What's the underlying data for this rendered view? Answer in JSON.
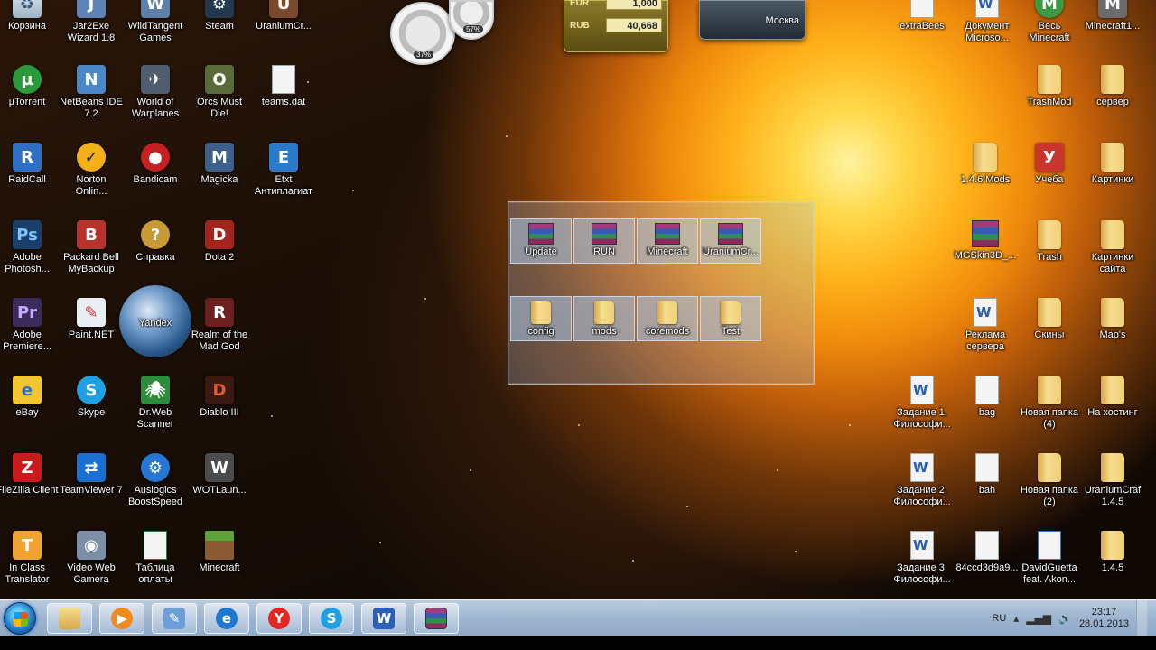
{
  "desktop": {
    "col1": [
      "Корзина",
      "µTorrent",
      "RaidCall",
      "Adobe Photosh...",
      "Adobe Premiere...",
      "eBay",
      "FileZilla Client",
      "In Class Translator"
    ],
    "col2": [
      "Jar2Exe Wizard 1.8",
      "NetBeans IDE 7.2",
      "Norton Onlin...",
      "Packard Bell MyBackup",
      "Paint.NET",
      "Skype",
      "TeamViewer 7",
      "Video Web Camera"
    ],
    "col3": [
      "WildTangent Games",
      "World of Warplanes",
      "Bandicam",
      "Справка",
      "Yandex",
      "Dr.Web Scanner",
      "Auslogics BoostSpeed",
      "Таблица оплаты"
    ],
    "col4": [
      "Steam",
      "Orcs Must Die!",
      "Magicka",
      "Dota 2",
      "Realm of the Mad God",
      "Diablo III",
      "WOTLaun...",
      "Minecraft"
    ],
    "col5": [
      "UraniumCr...",
      "teams.dat",
      "Etxt Антиплагиат"
    ],
    "right_a": [
      "extraBees",
      "1.4.6 Mods",
      "MGSkin3D_...",
      "Реклама сервера",
      "Задание 1. Философи...",
      "Задание 2. Философи...",
      "Задание 3. Философи..."
    ],
    "right_b": [
      "Документ Microso...",
      "bag",
      "bah",
      "84ccd3d9a9..."
    ],
    "right_c": [
      "Весь Minecraft",
      "TrashMod",
      "Учеба",
      "Trash",
      "Скины",
      "Новая папка (4)",
      "Новая папка (2)",
      "DavidGuetta feat. Akon..."
    ],
    "right_d": [
      "Minecraft1...",
      "сервер",
      "Картинки",
      "Картинки сайта",
      "Map's",
      "На хостинг",
      "UraniumCraf 1.4.5",
      "1.4.5"
    ]
  },
  "fence": {
    "archives": [
      "Update",
      "RUN",
      "Minecraft",
      "UraniumCr..."
    ],
    "folders": [
      "config",
      "mods",
      "coremods",
      "Test"
    ]
  },
  "gadgets": {
    "cpu_percent": "37%",
    "mem_percent": "57%",
    "currency_top_code": "EUR",
    "currency_top_value": "1,000",
    "currency_code": "RUB",
    "currency_value": "40,668",
    "weather_city": "Москва"
  },
  "taskbar": {
    "language": "RU",
    "time": "23:17",
    "date": "28.01.2013",
    "pinned": [
      "Проводник",
      "Windows Media Player",
      "Paint",
      "Internet Explorer",
      "Yandex",
      "Skype",
      "Microsoft Word",
      "WinRAR"
    ]
  },
  "colors": {
    "taskbar": "#aac3e1",
    "fence_bg": "#96b4d7",
    "label_text": "#ffffff"
  }
}
